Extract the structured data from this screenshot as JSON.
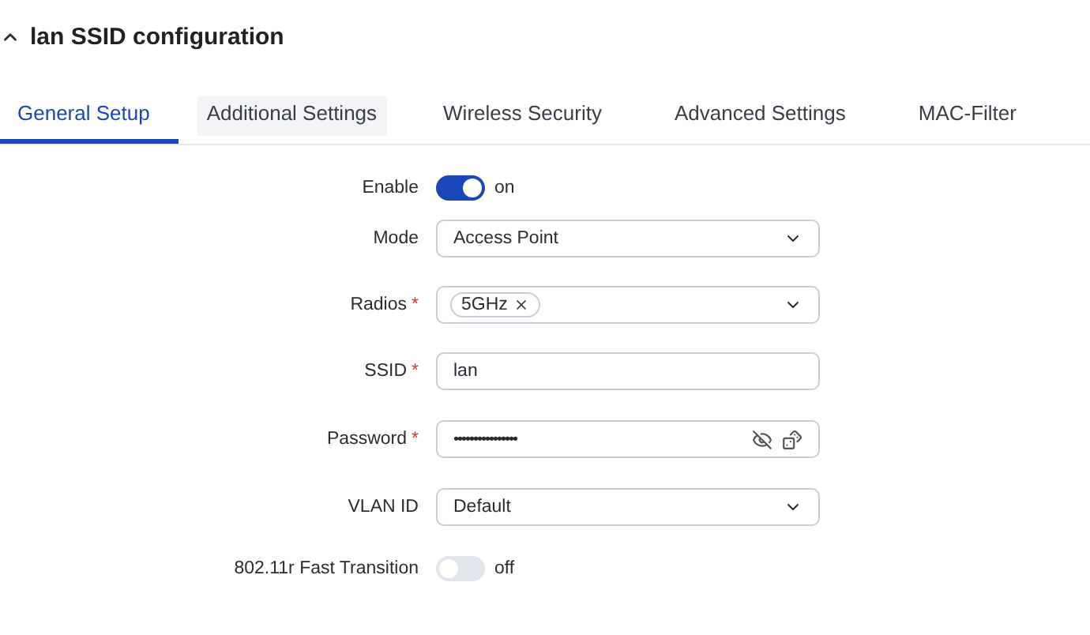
{
  "section": {
    "title": "lan SSID configuration",
    "expanded": true
  },
  "tabs": [
    {
      "label": "General Setup",
      "selected": true,
      "hovered": false
    },
    {
      "label": "Additional Settings",
      "selected": false,
      "hovered": true
    },
    {
      "label": "Wireless Security",
      "selected": false,
      "hovered": false
    },
    {
      "label": "Advanced Settings",
      "selected": false,
      "hovered": false
    },
    {
      "label": "MAC-Filter",
      "selected": false,
      "hovered": false
    }
  ],
  "fields": [
    {
      "kind": "toggle",
      "label": "Enable",
      "on": true,
      "state_text": "on"
    },
    {
      "kind": "select",
      "label": "Mode",
      "value": "Access Point"
    },
    {
      "kind": "tags",
      "label": "Radios",
      "required_mark": "*",
      "tags": [
        "5GHz"
      ]
    },
    {
      "kind": "text",
      "label": "SSID",
      "required_mark": "*",
      "value": "lan"
    },
    {
      "kind": "password",
      "label": "Password",
      "required_mark": "*",
      "value": "••••••••••••••••"
    },
    {
      "kind": "select",
      "label": "VLAN ID",
      "value": "Default"
    },
    {
      "kind": "toggle",
      "label": "802.11r Fast Transition",
      "on": false,
      "state_text": "off"
    }
  ]
}
